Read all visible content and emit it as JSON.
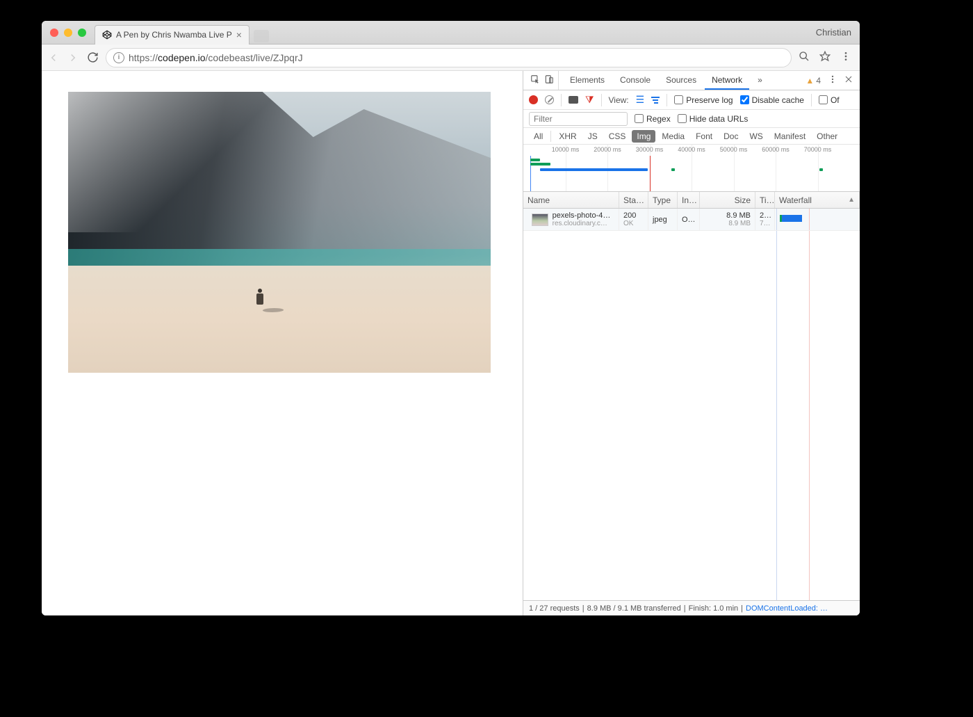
{
  "browser": {
    "tab_title": "A Pen by Chris Nwamba Live P",
    "profile": "Christian",
    "url_host": "codepen.io",
    "url_prefix": "https://",
    "url_path": "/codebeast/live/ZJpqrJ"
  },
  "devtools": {
    "tabs": [
      "Elements",
      "Console",
      "Sources",
      "Network"
    ],
    "active_tab": "Network",
    "more": "»",
    "warnings_count": "4",
    "controls": {
      "view_label": "View:",
      "preserve_log": "Preserve log",
      "disable_cache": "Disable cache",
      "offline_truncated": "Of"
    },
    "filter": {
      "placeholder": "Filter",
      "regex": "Regex",
      "hide_data_urls": "Hide data URLs"
    },
    "types": [
      "All",
      "XHR",
      "JS",
      "CSS",
      "Img",
      "Media",
      "Font",
      "Doc",
      "WS",
      "Manifest",
      "Other"
    ],
    "active_type": "Img",
    "timeline_ticks": [
      "10000 ms",
      "20000 ms",
      "30000 ms",
      "40000 ms",
      "50000 ms",
      "60000 ms",
      "70000 ms"
    ],
    "table": {
      "columns": [
        "Name",
        "Sta…",
        "Type",
        "In…",
        "Size",
        "Ti…",
        "Waterfall"
      ],
      "rows": [
        {
          "name": "pexels-photo-4…",
          "sub": "res.cloudinary.c…",
          "status": "200",
          "status_sub": "OK",
          "type": "jpeg",
          "initiator": "O…",
          "size": "8.9 MB",
          "size_sub": "8.9 MB",
          "time": "2…",
          "time_sub": "7…"
        }
      ]
    },
    "status_bar": {
      "requests": "1 / 27 requests",
      "transferred": "8.9 MB / 9.1 MB transferred",
      "finish": "Finish: 1.0 min",
      "domcontent": "DOMContentLoaded: …"
    }
  }
}
